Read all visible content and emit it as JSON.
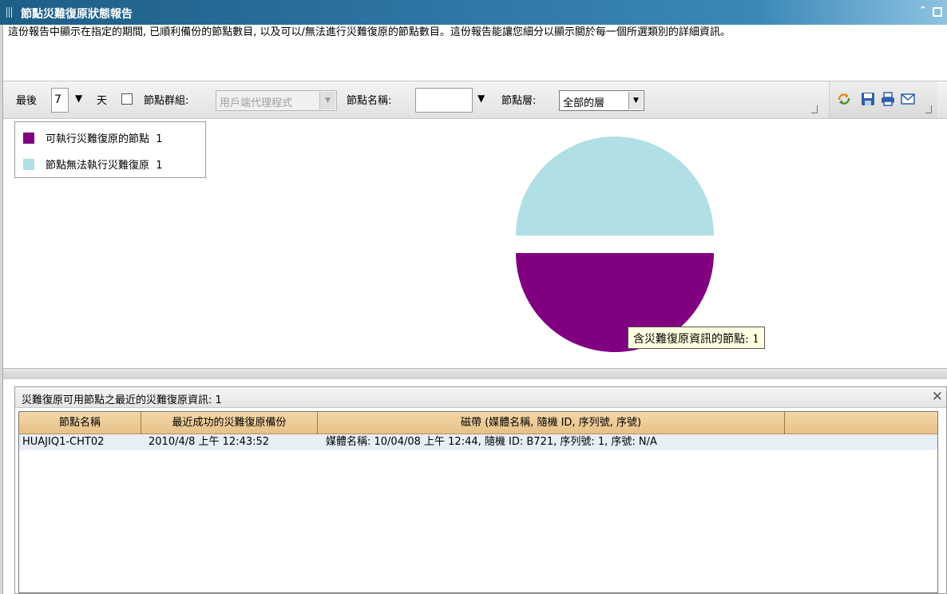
{
  "window": {
    "title": "節點災難復原狀態報告",
    "collapse_icon": "double-chevron-up-icon",
    "maximize_icon": "maximize-icon"
  },
  "description": "這份報告中顯示在指定的期間, 已順利備份的節點數目, 以及可以/無法進行災難復原的節點數目。這份報告能讓您細分以顯示關於每一個所選類別的詳細資訊。",
  "toolbar": {
    "last_label": "最後",
    "days_value": "7",
    "days_label": "天",
    "node_group_label": "節點群組:",
    "node_group_value": "用戶端代理程式",
    "node_name_label": "節點名稱:",
    "node_name_value": "",
    "node_layer_label": "節點層:",
    "node_layer_value": "全部的層",
    "icons": [
      "refresh-icon",
      "save-icon",
      "print-icon",
      "email-icon"
    ]
  },
  "chart_data": {
    "type": "pie",
    "title": "",
    "slices": [
      {
        "label": "可執行災難復原的節點",
        "value": 1,
        "color": "#800080"
      },
      {
        "label": "節點無法執行災難復原",
        "value": 1,
        "color": "#b0dfe5"
      }
    ],
    "legend_position": "top-left",
    "exploded": true,
    "tooltip": "含災難復原資訊的節點: 1"
  },
  "legend": {
    "items": [
      {
        "label": "可執行災難復原的節點",
        "count": "1",
        "color": "#800080"
      },
      {
        "label": "節點無法執行災難復原",
        "count": "1",
        "color": "#b0dfe5"
      }
    ]
  },
  "detail": {
    "title": "災難復原可用節點之最近的災難復原資訊: 1",
    "columns": [
      "節點名稱",
      "最近成功的災難復原備份",
      "磁帶 (媒體名稱, 隨機 ID, 序列號, 序號)",
      ""
    ],
    "rows": [
      [
        "HUAJIQ1-CHT02",
        "2010/4/8 上午 12:43:52",
        "媒體名稱: 10/04/08 上午 12:44, 隨機 ID: B721, 序列號: 1, 序號: N/A",
        ""
      ]
    ]
  }
}
